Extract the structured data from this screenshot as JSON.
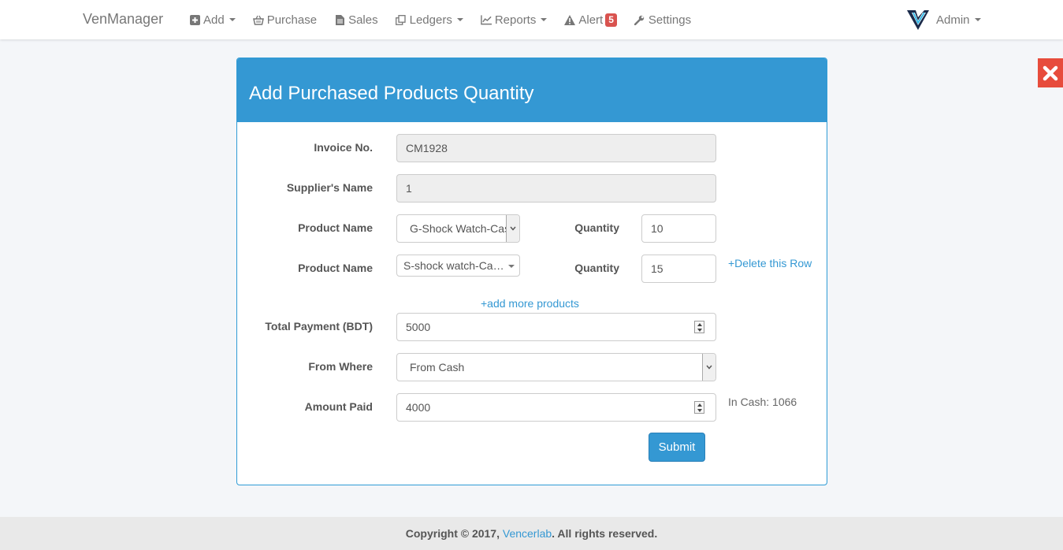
{
  "navbar": {
    "brand": "VenManager",
    "items": [
      {
        "label": "Add",
        "icon": "plus-square-icon",
        "dropdown": true
      },
      {
        "label": "Purchase",
        "icon": "basket-icon",
        "dropdown": false
      },
      {
        "label": "Sales",
        "icon": "file-icon",
        "dropdown": false
      },
      {
        "label": "Ledgers",
        "icon": "copy-icon",
        "dropdown": true
      },
      {
        "label": "Reports",
        "icon": "line-chart-icon",
        "dropdown": true
      },
      {
        "label": "Alert",
        "icon": "warning-icon",
        "dropdown": false,
        "badge": "5"
      },
      {
        "label": "Settings",
        "icon": "wrench-icon",
        "dropdown": false
      }
    ],
    "user": "Admin"
  },
  "form": {
    "title": "Add Purchased Products Quantity",
    "invoice_label": "Invoice No.",
    "invoice_value": "CM1928",
    "supplier_label": "Supplier's Name",
    "supplier_value": "1",
    "product_label": "Product Name",
    "quantity_label": "Quantity",
    "products": [
      {
        "name": "G-Shock Watch-Casio",
        "quantity": "10"
      },
      {
        "name": "S-shock watch-Ca…",
        "quantity": "15"
      }
    ],
    "delete_row": "+Delete this Row",
    "add_more": "+add more products",
    "total_label": "Total Payment (BDT)",
    "total_value": "5000",
    "from_label": "From Where",
    "from_value": "From Cash",
    "paid_label": "Amount Paid",
    "paid_value": "4000",
    "in_cash": "In Cash: 1066",
    "submit": "Submit"
  },
  "footer": {
    "prefix": "Copyright © 2017, ",
    "link": "Vencerlab",
    "suffix": ". All rights reserved."
  },
  "colors": {
    "primary": "#3498d3",
    "danger": "#e74c3c",
    "badge": "#d9534f"
  }
}
